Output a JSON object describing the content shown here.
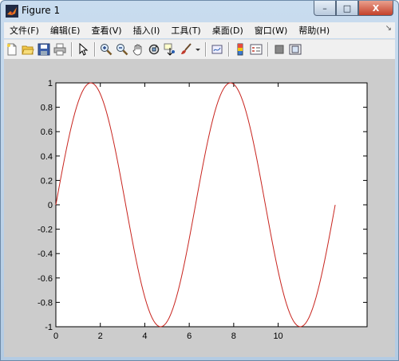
{
  "window": {
    "title": "Figure 1",
    "buttons": {
      "minimize": "–",
      "maximize": "□",
      "close": "X"
    }
  },
  "menubar": {
    "items": [
      {
        "label": "文件(F)",
        "name": "file"
      },
      {
        "label": "编辑(E)",
        "name": "edit"
      },
      {
        "label": "查看(V)",
        "name": "view"
      },
      {
        "label": "插入(I)",
        "name": "insert"
      },
      {
        "label": "工具(T)",
        "name": "tools"
      },
      {
        "label": "桌面(D)",
        "name": "desktop"
      },
      {
        "label": "窗口(W)",
        "name": "window"
      },
      {
        "label": "帮助(H)",
        "name": "help"
      }
    ],
    "pin": "↘"
  },
  "toolbar": {
    "icons": [
      "new-figure-icon",
      "open-file-icon",
      "save-icon",
      "print-icon",
      "edit-plot-arrow-icon",
      "zoom-in-icon",
      "zoom-out-icon",
      "pan-hand-icon",
      "rotate-3d-icon",
      "data-cursor-icon",
      "brush-icon",
      "brush-dropdown-icon",
      "link-plot-icon",
      "insert-colorbar-icon",
      "insert-legend-icon",
      "hide-plot-tools-icon",
      "show-plot-tools-icon"
    ]
  },
  "chart_data": {
    "type": "line",
    "title": "",
    "xlabel": "",
    "ylabel": "",
    "xlim": [
      0,
      14
    ],
    "ylim": [
      -1,
      1
    ],
    "xticks": [
      0,
      2,
      4,
      6,
      8,
      10
    ],
    "xtick_labels": [
      "0",
      "2",
      "4",
      "6",
      "8",
      "10"
    ],
    "yticks": [
      1,
      0.8,
      0.6,
      0.4,
      0.2,
      0,
      -0.2,
      -0.4,
      -0.6,
      -0.8,
      -1
    ],
    "ytick_labels": [
      "1",
      "0.8",
      "0.6",
      "0.4",
      "0.2",
      "0",
      "-0.2",
      "-0.4",
      "-0.6",
      "-0.8",
      "-1"
    ],
    "grid": false,
    "line_color": "#c8241e",
    "series": [
      {
        "x_start": 0,
        "x_end": 12.566,
        "samples": 160,
        "function": "sin"
      }
    ]
  }
}
